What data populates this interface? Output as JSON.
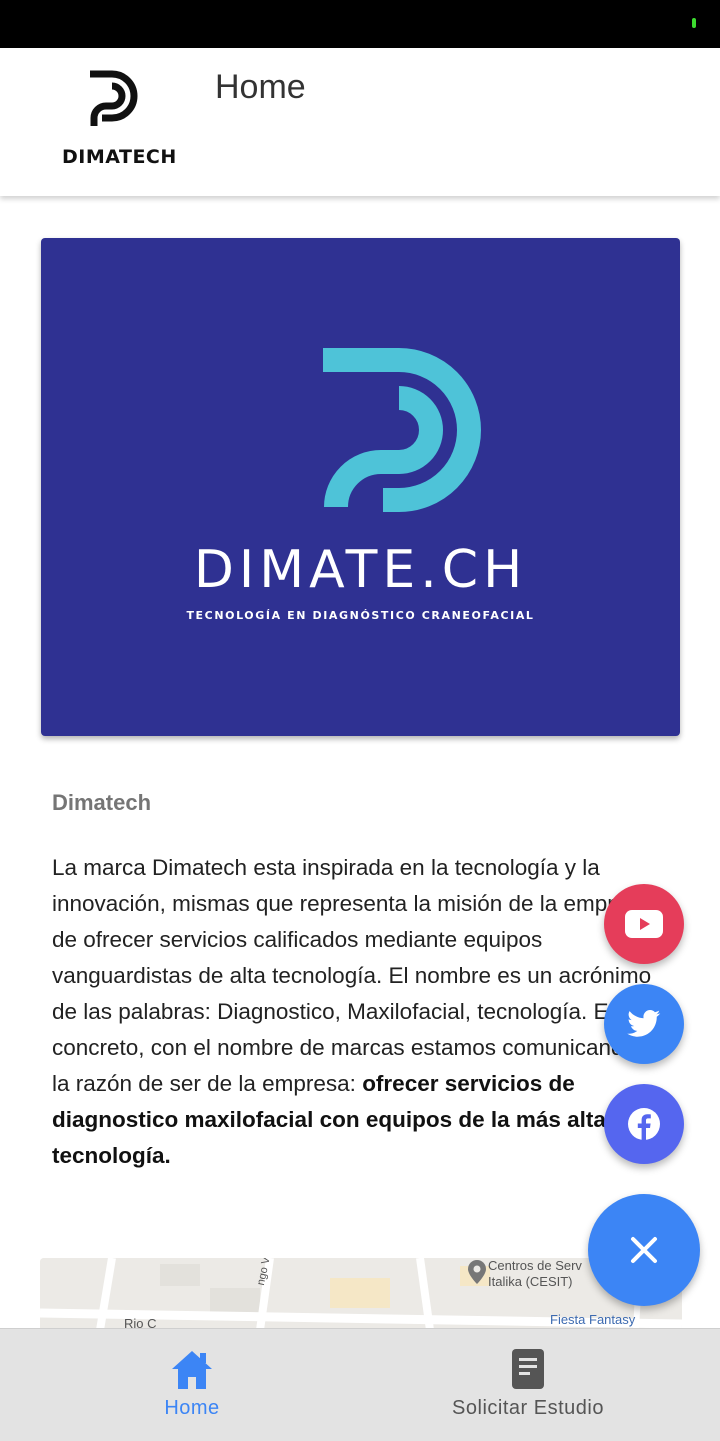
{
  "app_bar": {
    "logo_text": "DIMATECH",
    "title": "Home"
  },
  "hero": {
    "brand_name": "DIMATE.CH",
    "tagline": "TECNOLOGÍA EN DIAGNÓSTICO CRANEOFACIAL",
    "colors": {
      "background": "#2f3192",
      "mark": "#4ec3d8"
    }
  },
  "content": {
    "section_title": "Dimatech",
    "paragraph": "La marca Dimatech esta inspirada en la tecnología y la innovación, mismas que representa la misión de la empresa de ofrecer servicios calificados mediante equipos vanguardistas de alta tecnología. El nombre es un acrónimo de las palabras: Diagnostico, Maxilofacial, tecnología. En concreto, con el nombre de marcas estamos comunicando la razón de ser de la empresa:",
    "highlight": "ofrecer servicios de diagnostico maxilofacial con equipos de la más alta tecnología."
  },
  "map": {
    "labels": [
      "Centros de Serv",
      "Italika (CESIT)",
      "Fiesta Fantasy",
      "ngo Victoria",
      "Rio C"
    ]
  },
  "fabs": [
    {
      "icon": "youtube-icon",
      "color": "#e53d5a"
    },
    {
      "icon": "twitter-icon",
      "color": "#3c85f5"
    },
    {
      "icon": "facebook-icon",
      "color": "#5566ef"
    },
    {
      "icon": "close-icon",
      "color": "#3c85f5"
    }
  ],
  "bottom_nav": {
    "items": [
      {
        "label": "Home",
        "icon": "home-icon",
        "active": true
      },
      {
        "label": "Solicitar Estudio",
        "icon": "document-icon",
        "active": false
      }
    ]
  }
}
